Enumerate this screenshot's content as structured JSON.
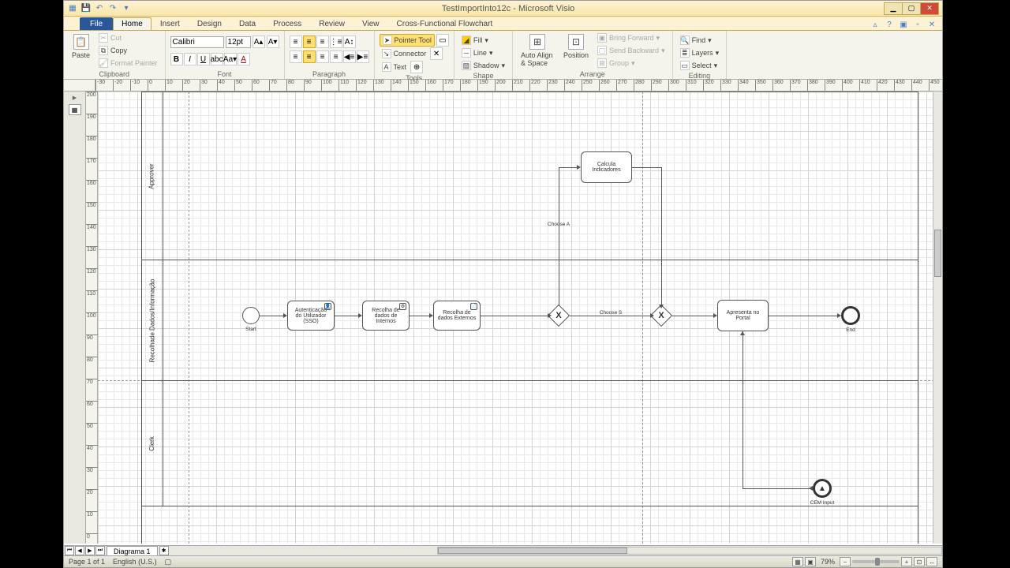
{
  "title": "TestImportInto12c - Microsoft Visio",
  "tabs": {
    "file": "File",
    "home": "Home",
    "insert": "Insert",
    "design": "Design",
    "data": "Data",
    "process": "Process",
    "review": "Review",
    "view": "View",
    "cff": "Cross-Functional Flowchart"
  },
  "ribbon": {
    "clipboard": {
      "paste": "Paste",
      "cut": "Cut",
      "copy": "Copy",
      "format_painter": "Format Painter",
      "label": "Clipboard"
    },
    "font": {
      "name": "Calibri",
      "size": "12pt",
      "label": "Font"
    },
    "paragraph": {
      "label": "Paragraph"
    },
    "tools": {
      "pointer": "Pointer Tool",
      "connector": "Connector",
      "text": "Text",
      "label": "Tools"
    },
    "shape": {
      "fill": "Fill",
      "line": "Line",
      "shadow": "Shadow",
      "label": "Shape"
    },
    "arrange": {
      "auto_align": "Auto Align & Space",
      "position": "Position",
      "bring_forward": "Bring Forward",
      "send_backward": "Send Backward",
      "group": "Group",
      "label": "Arrange"
    },
    "editing": {
      "find": "Find",
      "layers": "Layers",
      "select": "Select",
      "label": "Editing"
    }
  },
  "lanes": {
    "approver": "Approver",
    "recolha": "Recolhade Dados/Informação",
    "clerk": "Clerk"
  },
  "shapes": {
    "start_label": "Start",
    "end_label": "End",
    "task1": "Autenticação do Utilizador (SSO)",
    "task2": "Recolha de dados de Internos",
    "task3": "Recolha de dados Externos",
    "task4": "Calcula Indicadores",
    "task5": "Apresenta no Portal",
    "conn_choose_a": "Choose A",
    "conn_choose_s": "Choose S",
    "cem_label": "CEM Input"
  },
  "page_tab": "Diagrama 1",
  "status": {
    "page": "Page 1 of 1",
    "lang": "English (U.S.)",
    "zoom": "79%"
  },
  "ruler_h": [
    "-30",
    "-20",
    "-10",
    "0",
    "10",
    "20",
    "30",
    "40",
    "50",
    "60",
    "70",
    "80",
    "90",
    "100",
    "110",
    "120",
    "130",
    "140",
    "150",
    "160",
    "170",
    "180",
    "190",
    "200",
    "210",
    "220",
    "230",
    "240",
    "250",
    "260",
    "270",
    "280",
    "290",
    "300",
    "310",
    "320",
    "330",
    "340",
    "350",
    "360",
    "370",
    "380",
    "390",
    "400",
    "410",
    "420",
    "430",
    "440",
    "450"
  ],
  "ruler_v": [
    "200",
    "190",
    "180",
    "170",
    "160",
    "150",
    "140",
    "130",
    "120",
    "110",
    "100",
    "90",
    "80",
    "70",
    "60",
    "50",
    "40",
    "30",
    "20",
    "10",
    "0"
  ]
}
